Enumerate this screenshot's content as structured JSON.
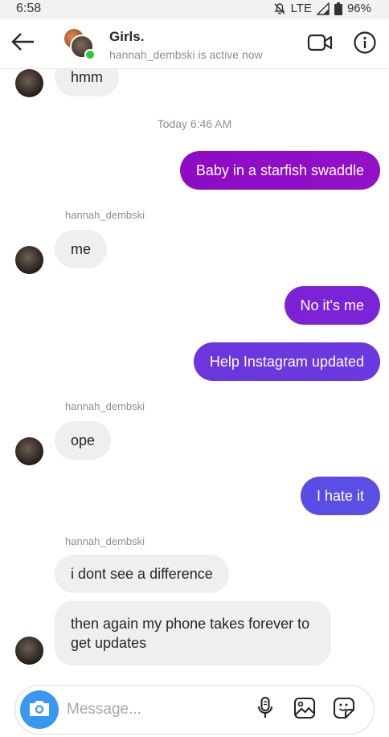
{
  "status_bar": {
    "time": "6:58",
    "network": "LTE",
    "battery": "96%"
  },
  "header": {
    "title": "Girls.",
    "subtitle": "hannah_dembski is active now",
    "icons": [
      "back-arrow-icon",
      "video-call-icon",
      "info-icon"
    ]
  },
  "messages": [
    {
      "type": "in",
      "sender": "",
      "text": "hmm"
    },
    {
      "type": "timestamp",
      "text": "Today 6:46 AM"
    },
    {
      "type": "out",
      "text": "Baby in a starfish swaddle"
    },
    {
      "type": "in",
      "sender": "hannah_dembski",
      "text": "me"
    },
    {
      "type": "out",
      "text": "No it's me"
    },
    {
      "type": "out",
      "text": "Help Instagram updated"
    },
    {
      "type": "in",
      "sender": "hannah_dembski",
      "text": "ope"
    },
    {
      "type": "out",
      "text": "I hate it"
    },
    {
      "type": "in",
      "sender": "hannah_dembski",
      "text": "i dont see a difference"
    },
    {
      "type": "in",
      "sender": "",
      "text": "then again my phone takes forever to get updates"
    }
  ],
  "composer": {
    "placeholder": "Message...",
    "icons": [
      "camera-icon",
      "microphone-icon",
      "gallery-icon",
      "sticker-icon"
    ]
  },
  "colors": {
    "outgoing_gradient": [
      "#8a0fc7",
      "#7a24d9",
      "#6a3ae0",
      "#5a50e6"
    ],
    "incoming_bubble": "#efefef",
    "camera_button": "#3897f0",
    "online_dot": "#2ec73b"
  }
}
